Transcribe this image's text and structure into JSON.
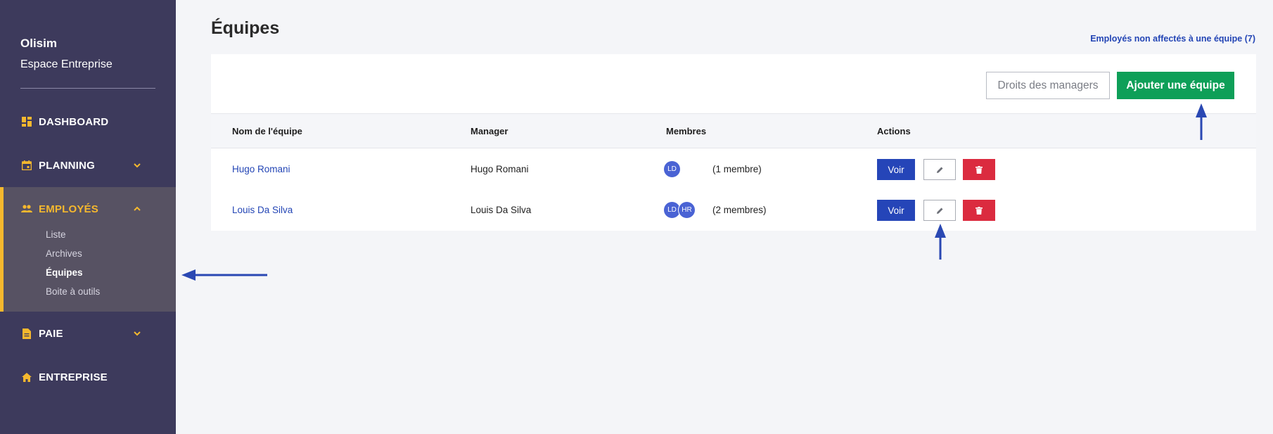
{
  "sidebar": {
    "brand": "Olisim",
    "brand_sub": "Espace Entreprise",
    "items": [
      {
        "label": "DASHBOARD",
        "icon": "dashboard-icon"
      },
      {
        "label": "PLANNING",
        "icon": "calendar-icon"
      },
      {
        "label": "EMPLOYÉS",
        "icon": "people-icon"
      },
      {
        "label": "PAIE",
        "icon": "document-icon"
      },
      {
        "label": "ENTREPRISE",
        "icon": "home-icon"
      }
    ],
    "sub_items": [
      "Liste",
      "Archives",
      "Équipes",
      "Boite à outils"
    ],
    "accent": "#f5b82e"
  },
  "header": {
    "title": "Équipes",
    "unassigned_link": "Employés non affectés à une équipe (7)"
  },
  "toolbar": {
    "managers_rights": "Droits des managers",
    "add_team": "Ajouter une équipe"
  },
  "table": {
    "columns": [
      "Nom de l'équipe",
      "Manager",
      "Membres",
      "Actions"
    ],
    "rows": [
      {
        "team": "Hugo Romani",
        "manager": "Hugo Romani",
        "avatars": [
          "LD"
        ],
        "members": "(1 membre)",
        "view": "Voir"
      },
      {
        "team": "Louis Da Silva",
        "manager": "Louis Da Silva",
        "avatars": [
          "LD",
          "HR"
        ],
        "members": "(2 membres)",
        "view": "Voir"
      }
    ]
  },
  "colors": {
    "primary": "#2545b8",
    "success": "#0e9f58",
    "danger": "#db2b3f",
    "sidebar": "#3d3a5c"
  }
}
